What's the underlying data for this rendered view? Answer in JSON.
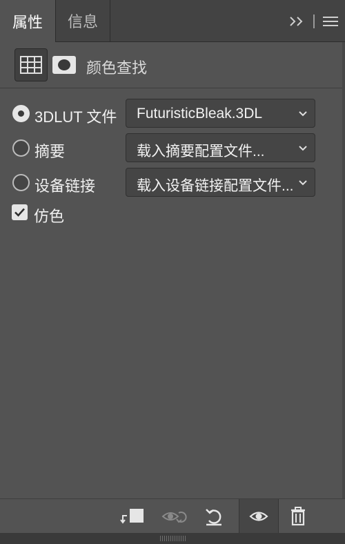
{
  "tabs": [
    {
      "label": "属性",
      "active": true
    },
    {
      "label": "信息",
      "active": false
    }
  ],
  "header": {
    "title": "颜色查找",
    "lut_icon": "grid-table-icon",
    "mask_icon": "layer-mask-icon"
  },
  "options": {
    "lut3d": {
      "label": "3DLUT 文件",
      "value": "FuturisticBleak.3DL",
      "checked": true
    },
    "abstract": {
      "label": "摘要",
      "value": "载入摘要配置文件...",
      "checked": false
    },
    "device_link": {
      "label": "设备链接",
      "value": "载入设备链接配置文件...",
      "checked": false
    },
    "dither": {
      "label": "仿色",
      "checked": true
    }
  },
  "toolbar": {
    "clip_icon": "clip-to-layer-icon",
    "view_previous_icon": "view-previous-state-icon",
    "reset_icon": "reset-icon",
    "visibility_icon": "eye-icon",
    "delete_icon": "trash-icon"
  },
  "colors": {
    "panel_bg": "#535353",
    "tab_bar_bg": "#434343",
    "control_bg": "#454545",
    "text": "#f0f0f0"
  }
}
